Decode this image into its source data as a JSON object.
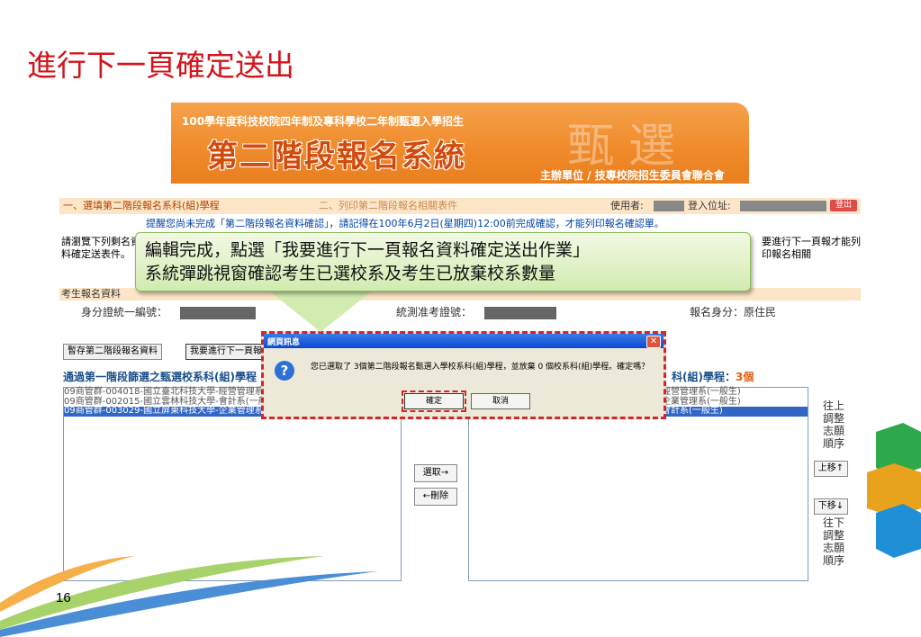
{
  "slide": {
    "title": "進行下一頁確定送出",
    "page_number": "16"
  },
  "banner": {
    "subtitle": "100學年度科技校院四年制及專科學校二年制甄選入學招生",
    "system_name": "第二階段報名系統",
    "watermark": "甄選",
    "organizer": "主辦單位 / 技專校院招生委員會聯合會"
  },
  "stepbar": {
    "step1": "一、選填第二階段報名系科(組)學程",
    "step2": "二、列印第二階段報名相關表件",
    "user_label": "使用者:",
    "ip_label": "登入位址:",
    "logout": "登出"
  },
  "reminder": "提醒您尚未完成「第二階段報名資料確認」，請記得在100年6月2日(星期四)12:00前完成確認，才能列印報名確認單。",
  "instructions": {
    "left": "請瀏覽下列剩名資料確定送表件。",
    "right": "要進行下一頁報才能列印報名相關"
  },
  "section_head": "考生報名資料",
  "applicant": {
    "id_label": "身分證統一編號：",
    "exam_no_label": "統測准考證號：",
    "identity_label": "報名身分：",
    "identity_value": "原住民"
  },
  "buttons": {
    "save": "暫存第二階段報名資料",
    "next": "我要進行下一頁報名資料確定送出作業",
    "select": "選取→",
    "delete": "←刪除",
    "move_up": "上移↑",
    "move_down": "下移↓"
  },
  "left_list": {
    "header": "通過第一階段篩選之甄選校系科(組)學程",
    "items": [
      "09商管群-004018-國立臺北科技大學-經營管理系(一般生)",
      "09商管群-002015-國立雲林科技大學-會計系(一般生)",
      "09商管群-003029-國立屏東科技大學-企業管理系(一般生)"
    ],
    "selected_index": 2
  },
  "right_list": {
    "header_prefix": "科(組)學程：",
    "count": "3個",
    "items": [
      "經營管理系(一般生)",
      "企業管理系(一般生)",
      "會計系(一般生)"
    ],
    "selected_index": 2
  },
  "side_labels": {
    "up": [
      "往上",
      "調整",
      "志願",
      "順序"
    ],
    "down": [
      "往下",
      "調整",
      "志願",
      "順序"
    ]
  },
  "dialog": {
    "title": "網頁訊息",
    "message": "您已選取了 3個第二階段報名甄選入學校系科(組)學程，並放棄 0 個校系科(組)學程。確定嗎？",
    "ok": "確定",
    "cancel": "取消"
  },
  "callout": {
    "line1": "編輯完成，點選「我要進行下一頁報名資料確定送出作業」",
    "line2": "系統彈跳視窗確認考生已選校系及考生已放棄校系數量"
  },
  "colors": {
    "title_red": "#d4141b",
    "banner_orange": "#ef8a2a",
    "callout_green": "#d2ebb0"
  }
}
